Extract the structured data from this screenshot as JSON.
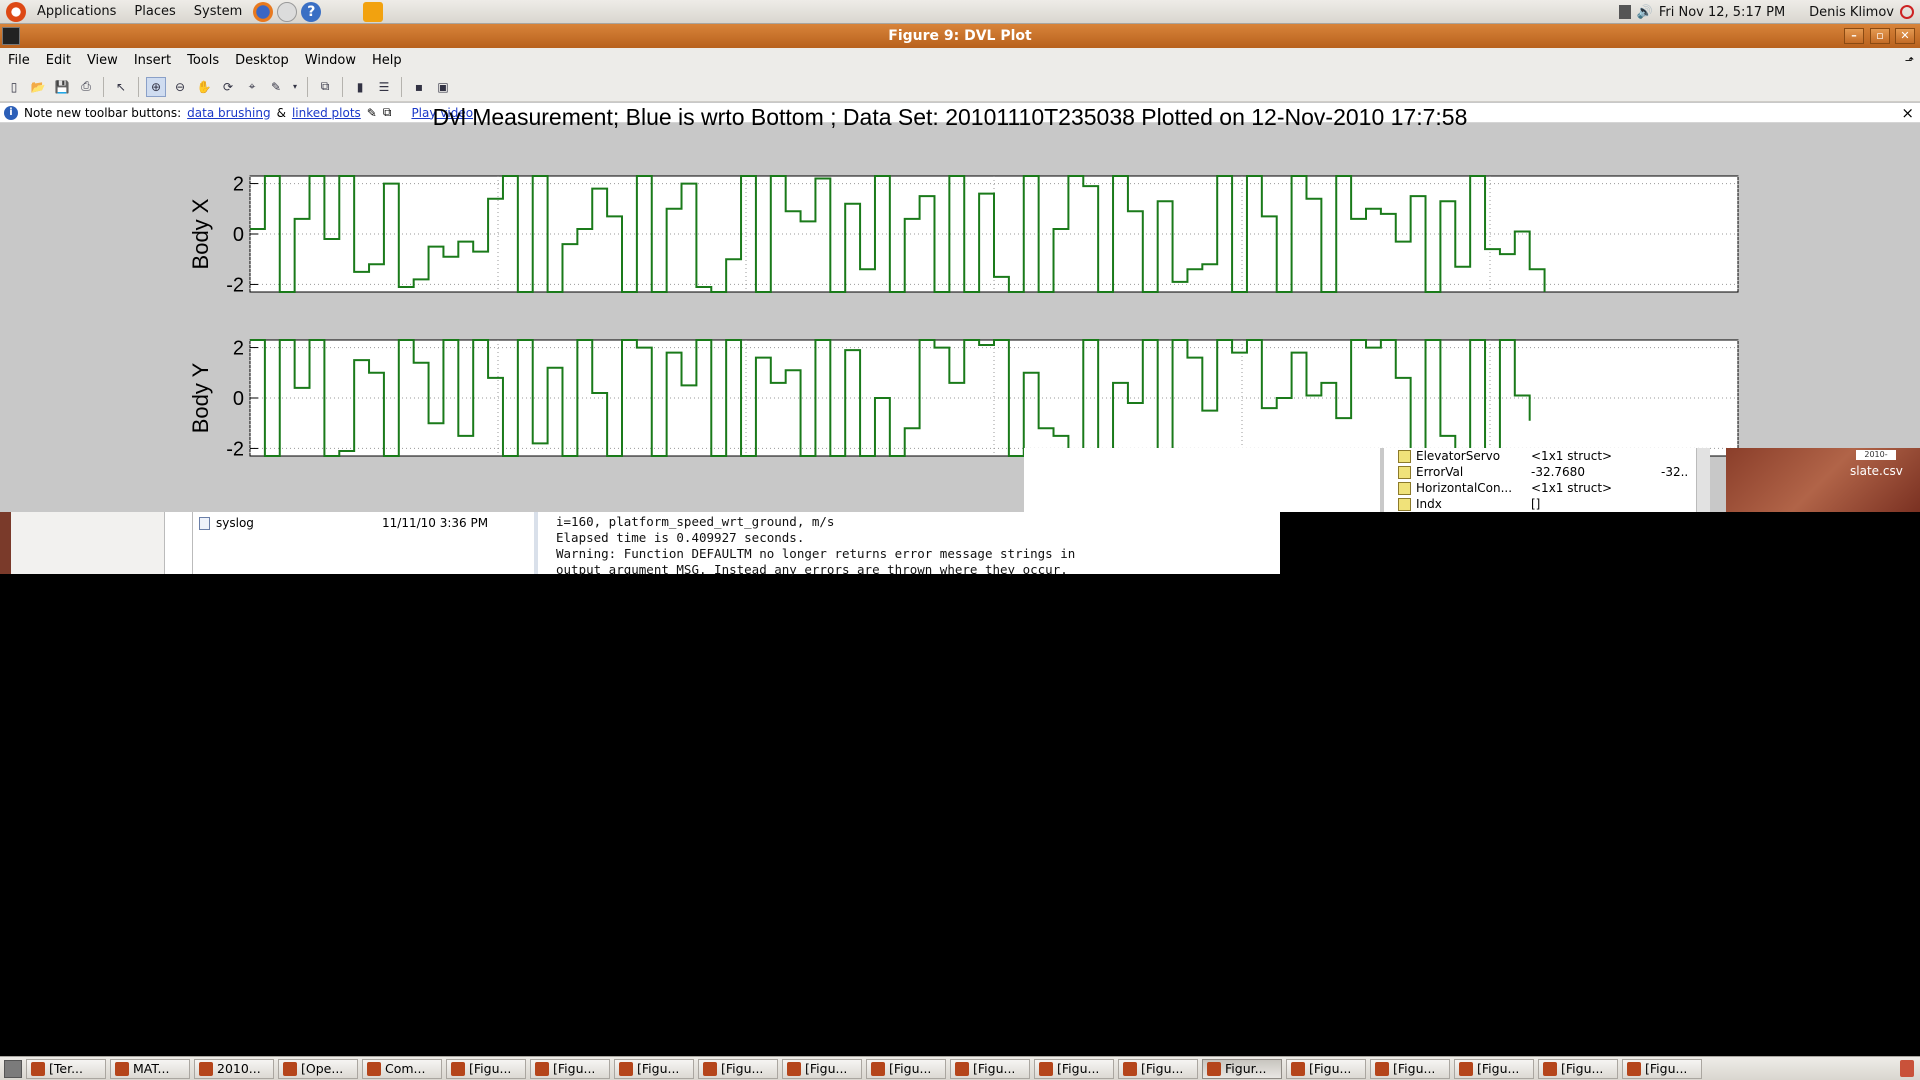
{
  "top_panel": {
    "menus": [
      "Applications",
      "Places",
      "System"
    ],
    "clock": "Fri Nov 12,  5:17 PM",
    "user": "Denis Klimov"
  },
  "window": {
    "title": "Figure 9: DVL Plot",
    "menus": [
      "File",
      "Edit",
      "View",
      "Insert",
      "Tools",
      "Desktop",
      "Window",
      "Help"
    ]
  },
  "infobar": {
    "text": "Note new toolbar buttons:",
    "link1": "data brushing",
    "amp": "&",
    "link2": "linked plots",
    "link3": "Play video",
    "close": "×"
  },
  "plot": {
    "title": "Dvl Measurement; Blue is wrto Bottom  ; Data Set: 20101110T235038 Plotted on 12-Nov-2010 17:7:58"
  },
  "chart_data": [
    {
      "type": "line",
      "ylabel": "Body X",
      "ylim": [
        -2.3,
        2.3
      ],
      "yticks": [
        2,
        0,
        -2
      ],
      "xlim": [
        0,
        300
      ],
      "grid": true,
      "series_color": "#1a7a1a",
      "x": [
        0,
        3,
        6,
        9,
        12,
        15,
        18,
        21,
        24,
        27,
        30,
        33,
        36,
        39,
        42,
        45,
        48,
        51,
        54,
        57,
        60,
        63,
        66,
        69,
        72,
        75,
        78,
        81,
        84,
        87,
        90,
        93,
        96,
        99,
        102,
        105,
        108,
        111,
        114,
        117,
        120,
        123,
        126,
        129,
        132,
        135,
        138,
        141,
        144,
        147,
        150,
        153,
        156,
        159,
        162,
        165,
        168,
        171,
        174,
        177,
        180,
        183,
        186,
        189,
        192,
        195,
        198,
        201,
        204,
        207,
        210,
        213,
        216,
        219,
        222,
        225,
        228,
        231,
        234,
        237,
        240,
        243,
        246,
        249,
        252,
        255,
        258,
        261
      ],
      "y": [
        0.2,
        2.3,
        -2.3,
        0.6,
        2.3,
        -0.2,
        2.3,
        -1.5,
        -1.2,
        2.0,
        -2.1,
        -1.8,
        -0.5,
        -0.9,
        -0.3,
        -0.7,
        1.4,
        2.3,
        -2.3,
        2.3,
        -2.3,
        -0.4,
        0.2,
        1.8,
        0.7,
        -2.3,
        2.3,
        -2.3,
        1.0,
        2.0,
        -2.1,
        -2.3,
        -1.0,
        2.3,
        -2.3,
        2.3,
        0.9,
        0.5,
        2.2,
        -2.3,
        1.2,
        -1.4,
        2.3,
        -2.3,
        0.6,
        1.5,
        -2.3,
        2.3,
        -2.3,
        1.6,
        -1.7,
        -2.3,
        2.3,
        -2.3,
        0.2,
        2.3,
        1.9,
        -2.3,
        2.3,
        0.9,
        -2.3,
        1.3,
        -1.9,
        -1.4,
        -1.2,
        2.3,
        -2.3,
        2.3,
        0.7,
        -2.3,
        2.3,
        1.4,
        -2.3,
        2.3,
        0.6,
        1.0,
        0.8,
        -0.3,
        1.5,
        -2.3,
        1.3,
        -1.3,
        2.3,
        -0.6,
        -0.8,
        0.1,
        -1.4,
        -2.3
      ]
    },
    {
      "type": "line",
      "ylabel": "Body Y",
      "ylim": [
        -2.3,
        2.3
      ],
      "yticks": [
        2,
        0,
        -2
      ],
      "xlim": [
        0,
        300
      ],
      "grid": true,
      "series_color": "#1a7a1a",
      "x": [
        0,
        3,
        6,
        9,
        12,
        15,
        18,
        21,
        24,
        27,
        30,
        33,
        36,
        39,
        42,
        45,
        48,
        51,
        54,
        57,
        60,
        63,
        66,
        69,
        72,
        75,
        78,
        81,
        84,
        87,
        90,
        93,
        96,
        99,
        102,
        105,
        108,
        111,
        114,
        117,
        120,
        123,
        126,
        129,
        132,
        135,
        138,
        141,
        144,
        147,
        150,
        153,
        156,
        159,
        162,
        165,
        168,
        171,
        174,
        177,
        180,
        183,
        186,
        189,
        192,
        195,
        198,
        201,
        204,
        207,
        210,
        213,
        216,
        219,
        222,
        225,
        228,
        231,
        234,
        237,
        240,
        243,
        246,
        249,
        252,
        255,
        258
      ],
      "y": [
        2.3,
        -2.3,
        2.3,
        0.4,
        2.3,
        -2.3,
        -2.1,
        1.5,
        1.0,
        -2.3,
        2.3,
        1.4,
        -1.0,
        2.3,
        -1.5,
        2.3,
        0.8,
        -2.3,
        2.3,
        -1.8,
        1.2,
        -2.3,
        2.3,
        0.2,
        -2.3,
        2.3,
        2.0,
        -2.3,
        1.8,
        0.5,
        2.3,
        -2.3,
        2.3,
        -2.3,
        1.6,
        0.6,
        1.1,
        -2.3,
        2.3,
        -2.3,
        1.9,
        -2.3,
        0.0,
        -2.3,
        -1.2,
        2.3,
        2.0,
        0.6,
        2.3,
        2.1,
        2.3,
        -2.3,
        1.0,
        -1.2,
        -1.5,
        -2.3,
        2.3,
        -2.3,
        0.6,
        -0.2,
        2.3,
        -2.3,
        2.3,
        1.6,
        -0.5,
        2.3,
        1.8,
        2.3,
        -0.4,
        0.0,
        1.8,
        0.1,
        0.6,
        -0.8,
        2.3,
        2.0,
        2.3,
        0.8,
        -2.3,
        2.3,
        -1.5,
        -2.3,
        2.3,
        -2.3,
        2.3,
        0.1,
        -0.9
      ]
    }
  ],
  "background": {
    "file_browser": {
      "name": "syslog",
      "date": "11/11/10 3:36 PM"
    },
    "command_window": [
      "i=160, platform_speed_wrt_ground, m/s",
      "Elapsed time is 0.409927 seconds.",
      "Warning: Function DEFAULTM no longer returns error message strings in",
      "output argument MSG. Instead any errors are thrown where they occur."
    ],
    "workspace": [
      {
        "name": "ElevatorServo",
        "value": "<1x1 struct>",
        "extra": ""
      },
      {
        "name": "ErrorVal",
        "value": "-32.7680",
        "extra": "-32.."
      },
      {
        "name": "HorizontalCon...",
        "value": "<1x1 struct>",
        "extra": ""
      },
      {
        "name": "Indx",
        "value": "[]",
        "extra": ""
      }
    ],
    "desktop_icon_label": "slate.csv",
    "desktop_icon_badge": "2010-"
  },
  "taskbar": {
    "tasks": [
      "[Ter...",
      "MAT...",
      "2010...",
      "[Ope...",
      "Com...",
      "[Figu...",
      "[Figu...",
      "[Figu...",
      "[Figu...",
      "[Figu...",
      "[Figu...",
      "[Figu...",
      "[Figu...",
      "[Figu...",
      "Figur...",
      "[Figu...",
      "[Figu...",
      "[Figu...",
      "[Figu...",
      "[Figu..."
    ],
    "active_index": 14
  }
}
